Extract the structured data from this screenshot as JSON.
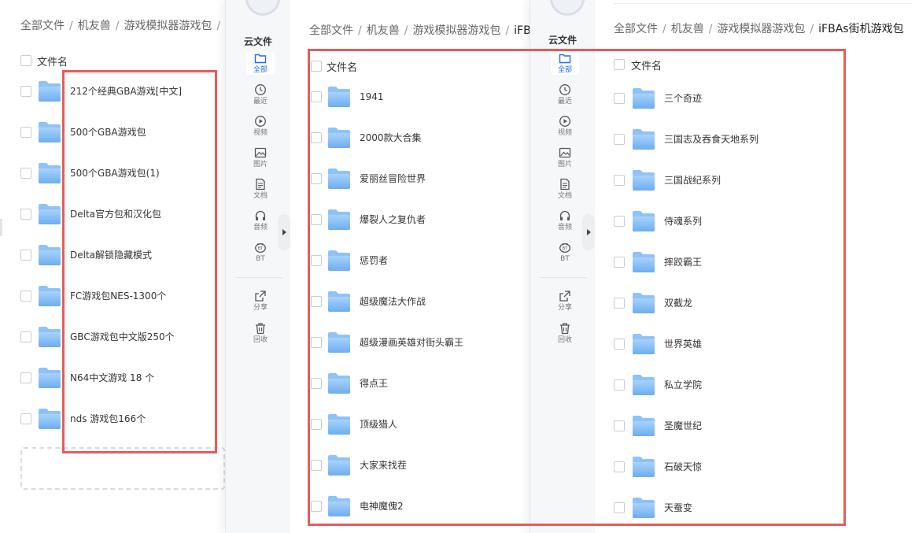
{
  "panel1": {
    "breadcrumb": {
      "items": [
        "全部文件",
        "机友兽",
        "游戏模拟器游戏包"
      ],
      "separator": "/"
    },
    "header": {
      "column_name": "文件名"
    },
    "files": [
      "212个经典GBA游戏[中文]",
      "500个GBA游戏包",
      "500个GBA游戏包(1)",
      "Delta官方包和汉化包",
      "Delta解锁隐藏模式",
      "FC游戏包NES-1300个",
      "GBC游戏包中文版250个",
      "N64中文游戏 18 个",
      "nds 游戏包166个"
    ]
  },
  "panel2": {
    "breadcrumb": {
      "items": [
        "全部文件",
        "机友兽",
        "游戏模拟器游戏包"
      ],
      "current": "iFB",
      "separator": "/"
    },
    "sidebar": {
      "group_title": "云文件",
      "nav": [
        "全部",
        "最近",
        "视频",
        "图片",
        "文档",
        "音频",
        "BT"
      ],
      "bt_badge": "BT",
      "extra": [
        "分享",
        "回收"
      ]
    },
    "header": {
      "column_name": "文件名"
    },
    "files": [
      "1941",
      "2000款大合集",
      "爱丽丝冒险世界",
      "爆裂人之复仇者",
      "惩罚者",
      "超级魔法大作战",
      "超级漫画英雄对街头霸王",
      "得点王",
      "顶级猎人",
      "大家来找茬",
      "电神魔傀2"
    ]
  },
  "panel3": {
    "breadcrumb": {
      "items": [
        "全部文件",
        "机友兽",
        "游戏模拟器游戏包"
      ],
      "current": "iFBAs街机游戏包",
      "separator": "/"
    },
    "sidebar": {
      "group_title": "云文件",
      "nav": [
        "全部",
        "最近",
        "视频",
        "图片",
        "文档",
        "音频",
        "BT"
      ],
      "bt_badge": "BT",
      "extra": [
        "分享",
        "回收"
      ]
    },
    "header": {
      "column_name": "文件名"
    },
    "files": [
      "三个奇迹",
      "三国志及吞食天地系列",
      "三国战纪系列",
      "侍魂系列",
      "摔跤霸王",
      "双截龙",
      "世界英雄",
      "私立学院",
      "圣魔世纪",
      "石破天惊",
      "天蚕变"
    ]
  },
  "colors": {
    "accent": "#2468f2",
    "highlight": "#e65b5b",
    "folder_top": "#9ccaf8",
    "folder_bottom": "#6fb0f2"
  }
}
